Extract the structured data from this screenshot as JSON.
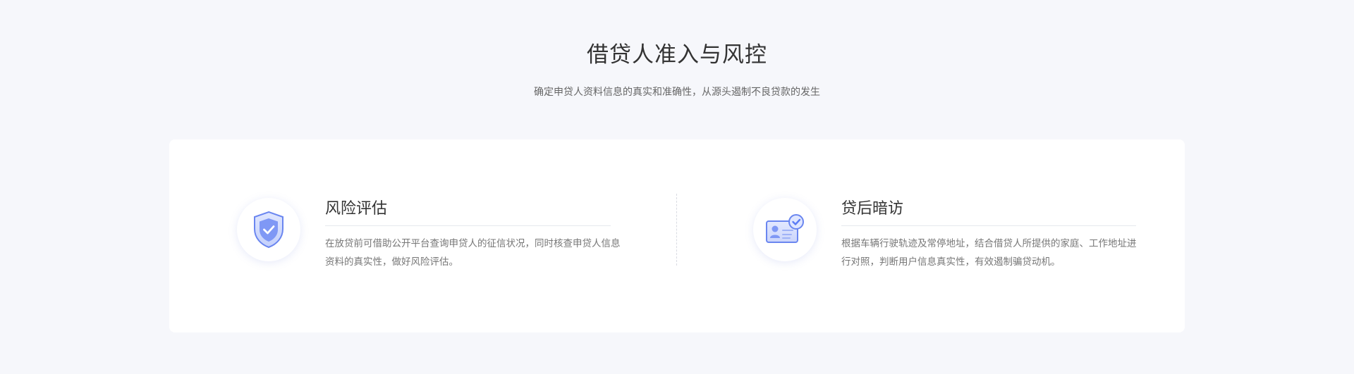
{
  "section": {
    "title": "借贷人准入与风控",
    "subtitle": "确定申贷人资料信息的真实和准确性，从源头遏制不良贷款的发生"
  },
  "features": [
    {
      "icon": "shield-check-icon",
      "title": "风险评估",
      "description": "在放贷前可借助公开平台查询申贷人的征信状况，同时核查申贷人信息资料的真实性，做好风险评估。"
    },
    {
      "icon": "id-card-check-icon",
      "title": "贷后暗访",
      "description": "根据车辆行驶轨迹及常停地址，结合借贷人所提供的家庭、工作地址进行对照，判断用户信息真实性，有效遏制骗贷动机。"
    }
  ],
  "colors": {
    "background": "#f6f7fb",
    "card": "#ffffff",
    "accent": "#5b7cf5",
    "title": "#333333",
    "text": "#777777"
  }
}
